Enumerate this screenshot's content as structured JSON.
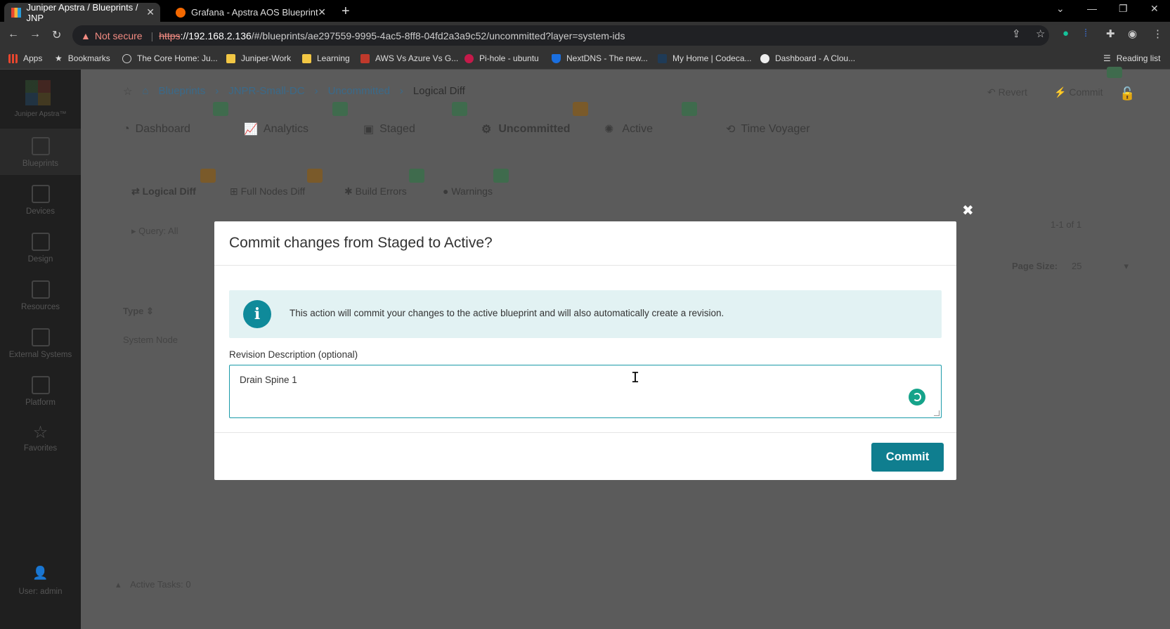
{
  "browser": {
    "tabs": [
      {
        "title": "Juniper Apstra / Blueprints / JNP",
        "active": true
      },
      {
        "title": "Grafana - Apstra AOS Blueprint",
        "active": false
      }
    ],
    "url": {
      "warning_label": "Not secure",
      "scheme": "https",
      "host": "://192.168.2.136",
      "path": "/#/blueprints/ae297559-9995-4ac5-8ff8-04fd2a3a9c52/uncommitted?layer=system-ids"
    },
    "bookmarks": [
      "Apps",
      "Bookmarks",
      "The Core Home: Ju...",
      "Juniper-Work",
      "Learning",
      "AWS Vs Azure Vs G...",
      "Pi-hole - ubuntu",
      "NextDNS - The new...",
      "My Home | Codeca...",
      "Dashboard - A Clou..."
    ],
    "reading_list": "Reading list"
  },
  "sidebar": {
    "brand": "Juniper Apstra™",
    "items": [
      "Blueprints",
      "Devices",
      "Design",
      "Resources",
      "External Systems",
      "Platform",
      "Favorites"
    ],
    "user": "User: admin"
  },
  "breadcrumb": [
    "Blueprints",
    "JNPR-Small-DC",
    "Uncommitted",
    "Logical Diff"
  ],
  "actions": {
    "revert": "Revert",
    "commit": "Commit"
  },
  "blueprint_tabs": [
    "Dashboard",
    "Analytics",
    "Staged",
    "Uncommitted",
    "Active",
    "Time Voyager"
  ],
  "sub_tabs": [
    "Logical Diff",
    "Full Nodes Diff",
    "Build Errors",
    "Warnings"
  ],
  "background": {
    "query": "Query: All",
    "page_count": "1-1 of 1",
    "page_size_label": "Page Size:",
    "page_size": "25",
    "column_type": "Type",
    "row_type": "System Node",
    "active_tasks": "Active Tasks: 0"
  },
  "modal": {
    "title": "Commit changes from Staged to Active?",
    "info": "This action will commit your changes to the active blueprint and will also automatically create a revision.",
    "field_label": "Revision Description (optional)",
    "field_value": "Drain Spine 1",
    "commit_label": "Commit",
    "close": "✖"
  },
  "colors": {
    "accent": "#0f7e8f",
    "info_bg": "#e2f2f3",
    "overlay": "#5b5b5b"
  }
}
